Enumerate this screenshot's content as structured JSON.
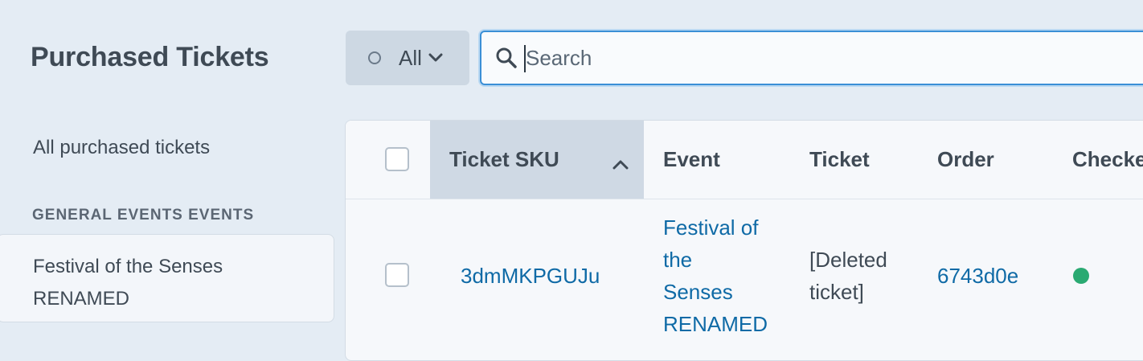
{
  "header": {
    "title": "Purchased Tickets",
    "status_filter": {
      "label": "All"
    },
    "search": {
      "placeholder": "Search",
      "value": ""
    }
  },
  "sidebar": {
    "all_link": "All purchased tickets",
    "section_heading": "GENERAL EVENTS EVENTS",
    "items": [
      {
        "line1": "Festival of the Senses",
        "line2": "RENAMED"
      }
    ]
  },
  "table": {
    "columns": [
      {
        "key": "sku",
        "label": "Ticket SKU",
        "sorted": "asc"
      },
      {
        "key": "event",
        "label": "Event"
      },
      {
        "key": "ticket",
        "label": "Ticket"
      },
      {
        "key": "order",
        "label": "Order"
      },
      {
        "key": "checked",
        "label": "Checke"
      }
    ],
    "rows": [
      {
        "sku": "3dmMKPGUJu",
        "event_lines": [
          "Festival of",
          "the",
          "Senses",
          "RENAMED"
        ],
        "ticket_lines": [
          "[Deleted",
          "ticket]"
        ],
        "order": "6743d0e",
        "checked_status_color": "#2aaa72"
      }
    ]
  },
  "colors": {
    "accent": "#3b8fd6",
    "link": "#0f6aa6",
    "status_green": "#2aaa72"
  }
}
